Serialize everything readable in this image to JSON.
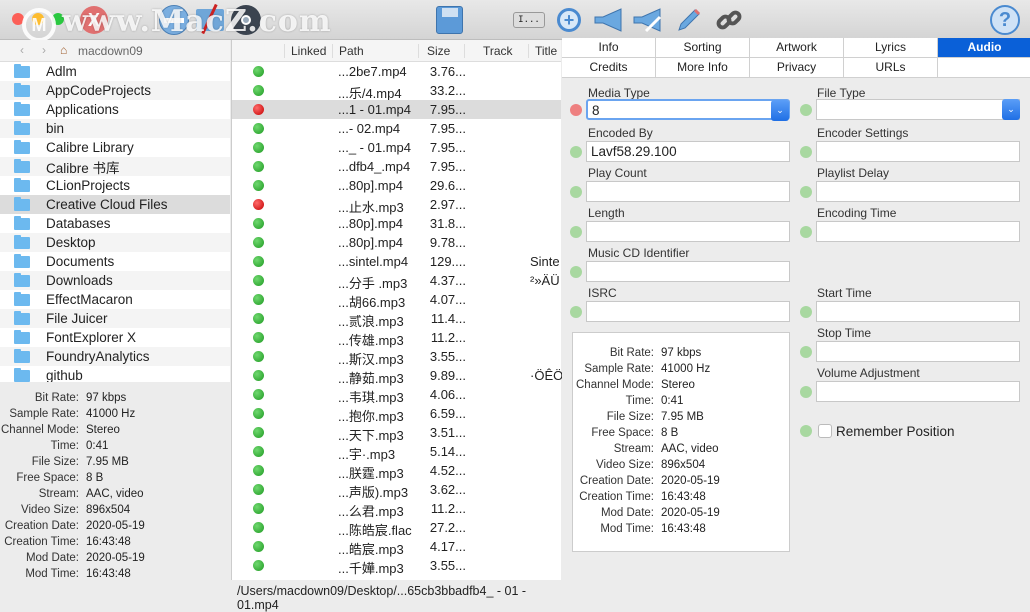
{
  "window": {
    "watermark": "www.MacZ.com",
    "watermark_logo": "M"
  },
  "toolbar": {
    "icons": [
      "close-x-icon",
      "remove-icon",
      "edit-folder-icon",
      "disc-icon",
      "save-icon",
      "text-field-icon",
      "zoom-in-icon",
      "announce-icon",
      "announce-edit-icon",
      "pencil-icon",
      "link-icon",
      "help-icon"
    ],
    "text_field_label": "I...",
    "help_label": "?"
  },
  "nav": {
    "current_folder": "macdown09"
  },
  "sidebar": {
    "items": [
      "Adlm",
      "AppCodeProjects",
      "Applications",
      "bin",
      "Calibre Library",
      "Calibre 书库",
      "CLionProjects",
      "Creative Cloud Files",
      "Databases",
      "Desktop",
      "Documents",
      "Downloads",
      "EffectMacaron",
      "File Juicer",
      "FontExplorer X",
      "FoundryAnalytics",
      "github"
    ],
    "selected": "Creative Cloud Files"
  },
  "left_info": [
    {
      "label": "Bit Rate:",
      "value": "97 kbps"
    },
    {
      "label": "Sample Rate:",
      "value": "41000 Hz"
    },
    {
      "label": "Channel Mode:",
      "value": "Stereo"
    },
    {
      "label": "Time:",
      "value": "0:41"
    },
    {
      "label": "File Size:",
      "value": "7.95 MB"
    },
    {
      "label": "Free Space:",
      "value": "8 B"
    },
    {
      "label": "Stream:",
      "value": "AAC, video"
    },
    {
      "label": "Video Size:",
      "value": "896x504"
    },
    {
      "label": "Creation Date:",
      "value": "2020-05-19"
    },
    {
      "label": "Creation Time:",
      "value": "16:43:48"
    },
    {
      "label": "Mod Date:",
      "value": "2020-05-19"
    },
    {
      "label": "Mod Time:",
      "value": "16:43:48"
    }
  ],
  "filelist": {
    "columns": [
      "Linked",
      "Path",
      "Size",
      "Track",
      "Title"
    ],
    "rows": [
      {
        "status": "green",
        "path": "...2be7.mp4",
        "size": "3.76...",
        "title": ""
      },
      {
        "status": "green",
        "path": "...乐/4.mp4",
        "size": "33.2...",
        "title": ""
      },
      {
        "status": "red",
        "path": "...1 - 01.mp4",
        "size": "7.95...",
        "title": "",
        "selected": true
      },
      {
        "status": "green",
        "path": "...- 02.mp4",
        "size": "7.95...",
        "title": ""
      },
      {
        "status": "green",
        "path": "..._ - 01.mp4",
        "size": "7.95...",
        "title": ""
      },
      {
        "status": "green",
        "path": "...dfb4_.mp4",
        "size": "7.95...",
        "title": ""
      },
      {
        "status": "green",
        "path": "...80p].mp4",
        "size": "29.6...",
        "title": ""
      },
      {
        "status": "red",
        "path": "...止水.mp3",
        "size": "2.97...",
        "title": ""
      },
      {
        "status": "green",
        "path": "...80p].mp4",
        "size": "31.8...",
        "title": ""
      },
      {
        "status": "green",
        "path": "...80p].mp4",
        "size": "9.78...",
        "title": ""
      },
      {
        "status": "green",
        "path": "...sintel.mp4",
        "size": "129....",
        "title": "Sinte"
      },
      {
        "status": "green",
        "path": "...分手 .mp3",
        "size": "4.37...",
        "title": "²»ÄÜ"
      },
      {
        "status": "green",
        "path": "...胡66.mp3",
        "size": "4.07...",
        "title": ""
      },
      {
        "status": "green",
        "path": "...贰浪.mp3",
        "size": "11.4...",
        "title": ""
      },
      {
        "status": "green",
        "path": "...传雄.mp3",
        "size": "11.2...",
        "title": ""
      },
      {
        "status": "green",
        "path": "...斯汉.mp3",
        "size": "3.55...",
        "title": ""
      },
      {
        "status": "green",
        "path": "...静茹.mp3",
        "size": "9.89...",
        "title": "·ÖÊÖ"
      },
      {
        "status": "green",
        "path": "...韦琪.mp3",
        "size": "4.06...",
        "title": ""
      },
      {
        "status": "green",
        "path": "...抱你.mp3",
        "size": "6.59...",
        "title": ""
      },
      {
        "status": "green",
        "path": "...天下.mp3",
        "size": "3.51...",
        "title": ""
      },
      {
        "status": "green",
        "path": "...宇·.mp3",
        "size": "5.14...",
        "title": ""
      },
      {
        "status": "green",
        "path": "...朕霆.mp3",
        "size": "4.52...",
        "title": ""
      },
      {
        "status": "green",
        "path": "...声版).mp3",
        "size": "3.62...",
        "title": ""
      },
      {
        "status": "green",
        "path": "...么君.mp3",
        "size": "11.2...",
        "title": ""
      },
      {
        "status": "green",
        "path": "...陈皓宸.flac",
        "size": "27.2...",
        "title": ""
      },
      {
        "status": "green",
        "path": "...皓宸.mp3",
        "size": "4.17...",
        "title": ""
      },
      {
        "status": "green",
        "path": "...千嬅.mp3",
        "size": "3.55...",
        "title": ""
      }
    ]
  },
  "statusbar": {
    "path": "/Users/macdown09/Desktop/...65cb3bbadfb4_ - 01 - 01.mp4"
  },
  "tabs": {
    "row1": [
      "Info",
      "Sorting",
      "Artwork",
      "Lyrics",
      "Audio"
    ],
    "row2": [
      "Credits",
      "More Info",
      "Privacy",
      "URLs",
      ""
    ],
    "active": "Audio"
  },
  "audio": {
    "media_type": {
      "label": "Media Type",
      "value": "8"
    },
    "file_type": {
      "label": "File Type",
      "value": ""
    },
    "encoded_by": {
      "label": "Encoded By",
      "value": "Lavf58.29.100"
    },
    "encoder_settings": {
      "label": "Encoder Settings",
      "value": ""
    },
    "play_count": {
      "label": "Play Count",
      "value": ""
    },
    "playlist_delay": {
      "label": "Playlist Delay",
      "value": ""
    },
    "length": {
      "label": "Length",
      "value": ""
    },
    "encoding_time": {
      "label": "Encoding Time",
      "value": ""
    },
    "music_cd_identifier": {
      "label": "Music CD Identifier",
      "value": ""
    },
    "isrc": {
      "label": "ISRC",
      "value": ""
    },
    "start_time": {
      "label": "Start Time",
      "value": ""
    },
    "stop_time": {
      "label": "Stop Time",
      "value": ""
    },
    "volume_adjustment": {
      "label": "Volume Adjustment",
      "value": ""
    },
    "remember_position": {
      "label": "Remember Position",
      "checked": false
    }
  },
  "colors": {
    "accent": "#0a60d8",
    "status_green": "#1f9a22",
    "status_red": "#c40000"
  }
}
